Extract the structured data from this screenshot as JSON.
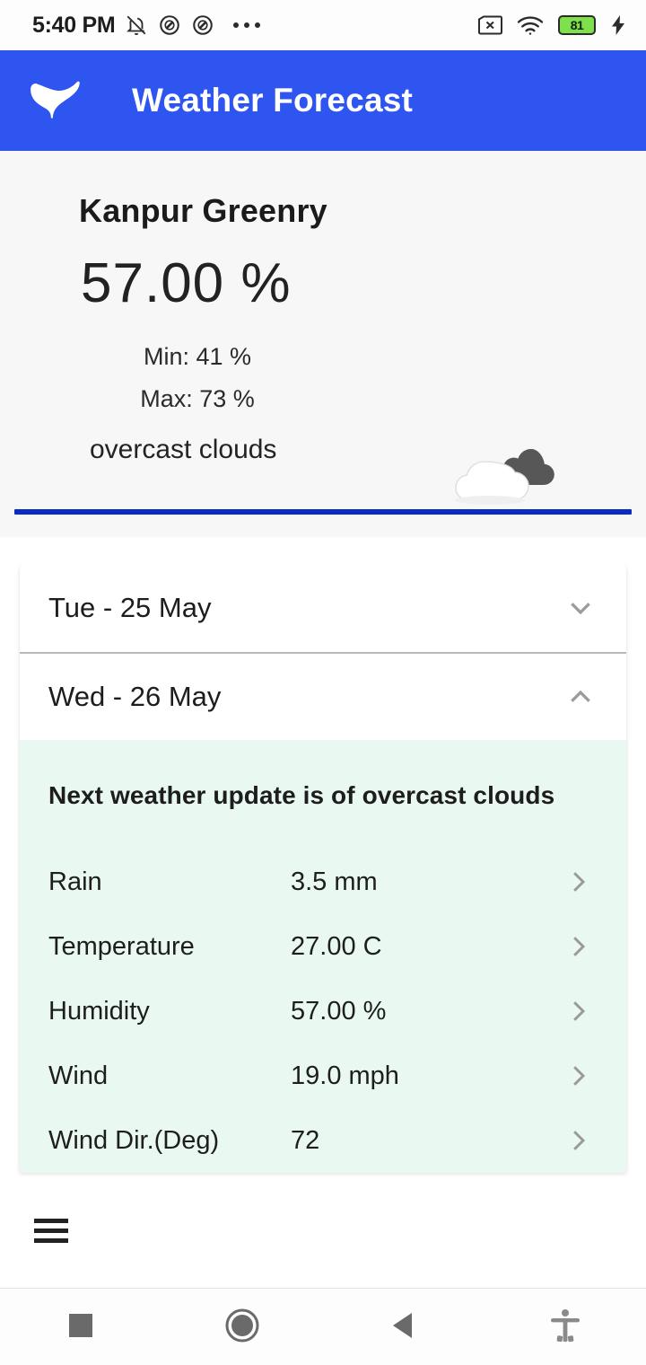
{
  "statusbar": {
    "time": "5:40 PM",
    "icons_left": [
      "notifications-off-icon",
      "do-not-disturb-icon",
      "do-not-disturb-icon",
      "overflow-dots-icon"
    ],
    "icons_right": [
      "sim-missing-icon",
      "wifi-icon",
      "battery-icon",
      "charging-bolt-icon"
    ],
    "battery_level": "81",
    "battery_color": "#7ee04a"
  },
  "appbar": {
    "title": "Weather Forecast",
    "logo": "bird-logo-icon",
    "background": "#2f55f0"
  },
  "current": {
    "city": "Kanpur Greenry",
    "value": "57.00 %",
    "min": "Min: 41 %",
    "max": "Max: 73 %",
    "description": "overcast clouds",
    "icon": "overcast-clouds-icon",
    "divider_color": "#0b2cc4"
  },
  "accordion": {
    "days": [
      {
        "label": "Tue - 25 May",
        "expanded": false,
        "chevron": "chevron-down-icon"
      },
      {
        "label": "Wed - 26 May",
        "expanded": true,
        "chevron": "chevron-up-icon"
      }
    ]
  },
  "panel": {
    "background": "#e9f9f1",
    "title": "Next weather update is of overcast clouds",
    "rows": [
      {
        "label": "Rain",
        "value": "3.5 mm",
        "chevron": "chevron-right-icon"
      },
      {
        "label": "Temperature",
        "value": "27.00 C",
        "chevron": "chevron-right-icon"
      },
      {
        "label": "Humidity",
        "value": "57.00 %",
        "chevron": "chevron-right-icon"
      },
      {
        "label": "Wind",
        "value": "19.0 mph",
        "chevron": "chevron-right-icon"
      },
      {
        "label": "Wind Dir.(Deg)",
        "value": "72",
        "chevron": "chevron-right-icon"
      }
    ]
  },
  "drawer": {
    "menu_icon": "hamburger-menu-icon"
  },
  "navbar": {
    "buttons": [
      {
        "name": "recents-button",
        "icon": "square-icon"
      },
      {
        "name": "home-button",
        "icon": "circle-icon"
      },
      {
        "name": "back-button",
        "icon": "triangle-left-icon"
      },
      {
        "name": "accessibility-button",
        "icon": "accessibility-person-icon"
      }
    ]
  }
}
